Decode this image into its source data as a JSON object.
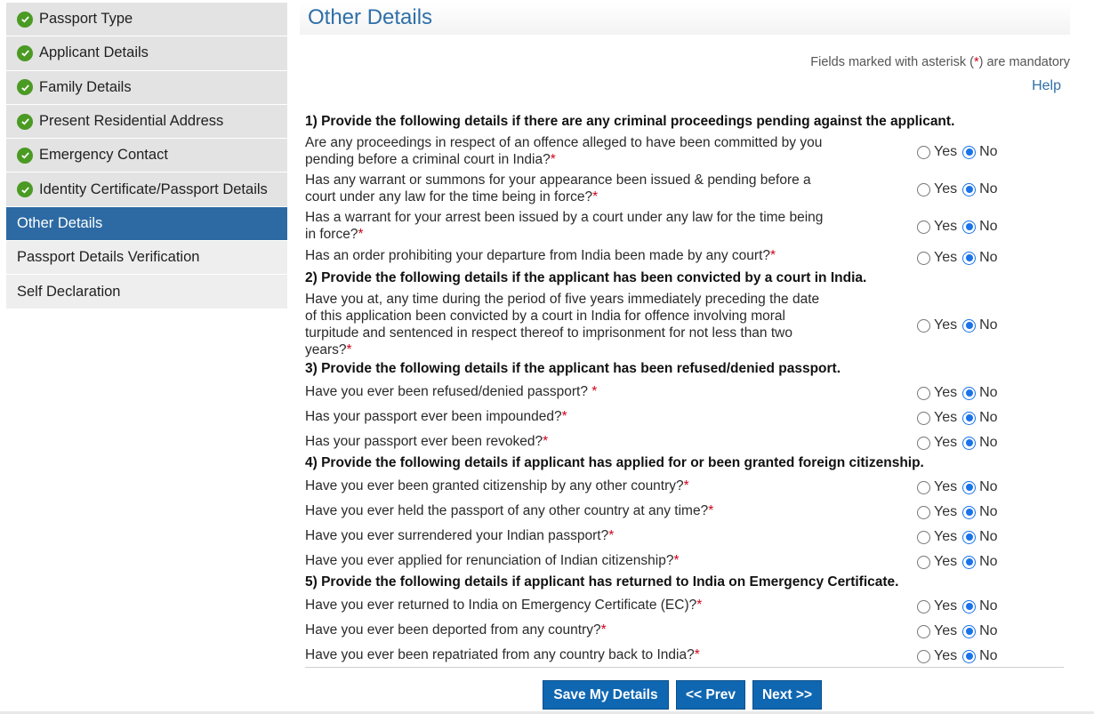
{
  "sidebar": {
    "items": [
      {
        "label": "Passport Type",
        "state": "done"
      },
      {
        "label": "Applicant Details",
        "state": "done"
      },
      {
        "label": "Family Details",
        "state": "done"
      },
      {
        "label": "Present Residential Address",
        "state": "done"
      },
      {
        "label": "Emergency Contact",
        "state": "done"
      },
      {
        "label": "Identity Certificate/Passport Details",
        "state": "done"
      },
      {
        "label": "Other Details",
        "state": "active"
      },
      {
        "label": "Passport Details Verification",
        "state": "pending"
      },
      {
        "label": "Self Declaration",
        "state": "pending"
      }
    ]
  },
  "header": {
    "title": "Other Details",
    "mandatory_note_prefix": "Fields marked with asterisk (",
    "mandatory_star": "*",
    "mandatory_note_suffix": ") are mandatory",
    "help": "Help"
  },
  "options": {
    "yes": "Yes",
    "no": "No"
  },
  "sections": [
    {
      "title": "1) Provide the following details if there are any criminal proceedings pending against the applicant.",
      "questions": [
        {
          "line1": "Are any proceedings in respect of an offence alleged to have been committed by you",
          "line2": "pending before a criminal court in India?",
          "answer": "No"
        },
        {
          "line1": "Has any warrant or summons for your appearance been issued & pending before a",
          "line2": "court under any law for the time being in force?",
          "answer": "No"
        },
        {
          "line1": "Has a warrant for your arrest been issued by a court under any law for the time being",
          "line2": "in force?",
          "answer": "No"
        },
        {
          "line1": "Has an order prohibiting your departure from India been made by any court?",
          "answer": "No"
        }
      ]
    },
    {
      "title": "2) Provide the following details if the applicant has been convicted by a court in India.",
      "questions": [
        {
          "line1": "Have you at, any time during the period of five years immediately preceding the date",
          "line2": "of this application been convicted by a court in India for offence involving moral",
          "line3": "turpitude and sentenced in respect thereof to imprisonment for not less than two",
          "line4": "years?",
          "answer": "No"
        }
      ]
    },
    {
      "title": "3) Provide the following details if the applicant has been refused/denied passport.",
      "questions": [
        {
          "line1": "Have you ever been refused/denied passport? ",
          "answer": "No"
        },
        {
          "line1": "Has your passport ever been impounded?",
          "answer": "No"
        },
        {
          "line1": "Has your passport ever been revoked?",
          "answer": "No"
        }
      ]
    },
    {
      "title": "4) Provide the following details if applicant has applied for or been granted foreign citizenship.",
      "questions": [
        {
          "line1": "Have you ever been granted citizenship by any other country?",
          "answer": "No"
        },
        {
          "line1": "Have you ever held the passport of any other country at any time?",
          "answer": "No"
        },
        {
          "line1": "Have you ever surrendered your Indian passport?",
          "answer": "No"
        },
        {
          "line1": "Have you ever applied for renunciation of Indian citizenship?",
          "answer": "No"
        }
      ]
    },
    {
      "title": "5) Provide the following details if applicant has returned to India on Emergency Certificate.",
      "questions": [
        {
          "line1": "Have you ever returned to India on Emergency Certificate (EC)?",
          "answer": "No"
        },
        {
          "line1": "Have you ever been deported from any country?",
          "answer": "No"
        },
        {
          "line1": "Have you ever been repatriated from any country back to India?",
          "answer": "No"
        }
      ]
    }
  ],
  "required_mark": "*",
  "footer": {
    "save": "Save My Details",
    "prev": "<< Prev",
    "next": "Next >>"
  }
}
